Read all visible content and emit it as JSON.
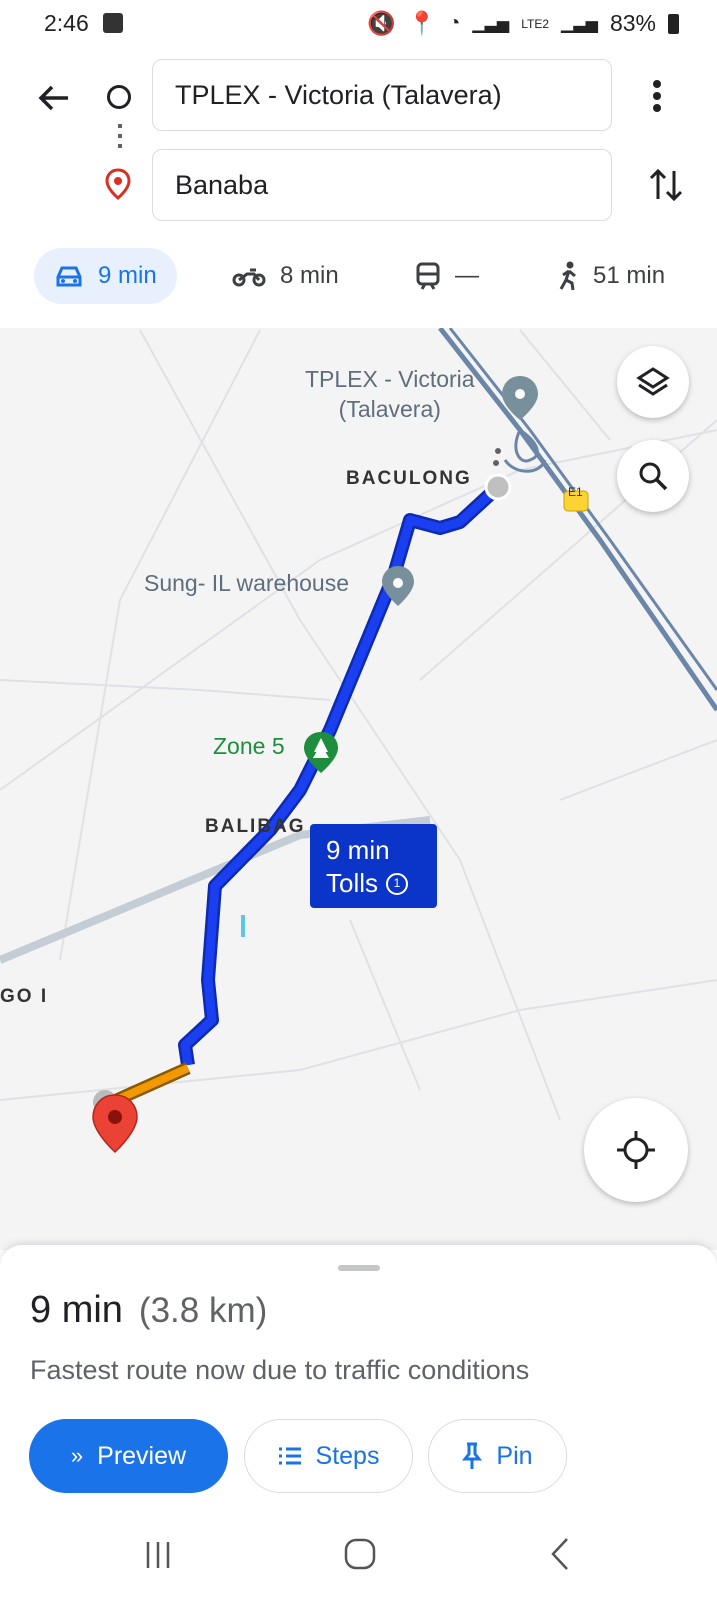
{
  "status_bar": {
    "time": "2:46",
    "battery": "83%",
    "network": "LTE2"
  },
  "route": {
    "origin": "TPLEX - Victoria (Talavera)",
    "destination": "Banaba"
  },
  "modes": [
    {
      "icon": "car-icon",
      "label": "9 min"
    },
    {
      "icon": "motorcycle-icon",
      "label": "8 min"
    },
    {
      "icon": "train-icon",
      "label": "—"
    },
    {
      "icon": "walk-icon",
      "label": "51 min"
    }
  ],
  "map": {
    "labels": {
      "origin_line1": "TPLEX - Victoria",
      "origin_line2": "(Talavera)",
      "baculong": "BACULONG",
      "warehouse": "Sung- IL warehouse",
      "zone5": "Zone 5",
      "balibago": "BALIBAG",
      "goi": "GO I",
      "highway_badge": "E1"
    },
    "callout": {
      "time": "9 min",
      "tolls": "Tolls"
    },
    "colors": {
      "route": "#1a3ff0",
      "route_slow": "#f29900",
      "callout": "#0b34c9"
    }
  },
  "summary": {
    "duration": "9 min",
    "distance": "(3.8 km)",
    "note": "Fastest route now due to traffic conditions"
  },
  "actions": {
    "preview": "Preview",
    "steps": "Steps",
    "pin": "Pin"
  },
  "colors": {
    "accent": "#1a73e8"
  }
}
